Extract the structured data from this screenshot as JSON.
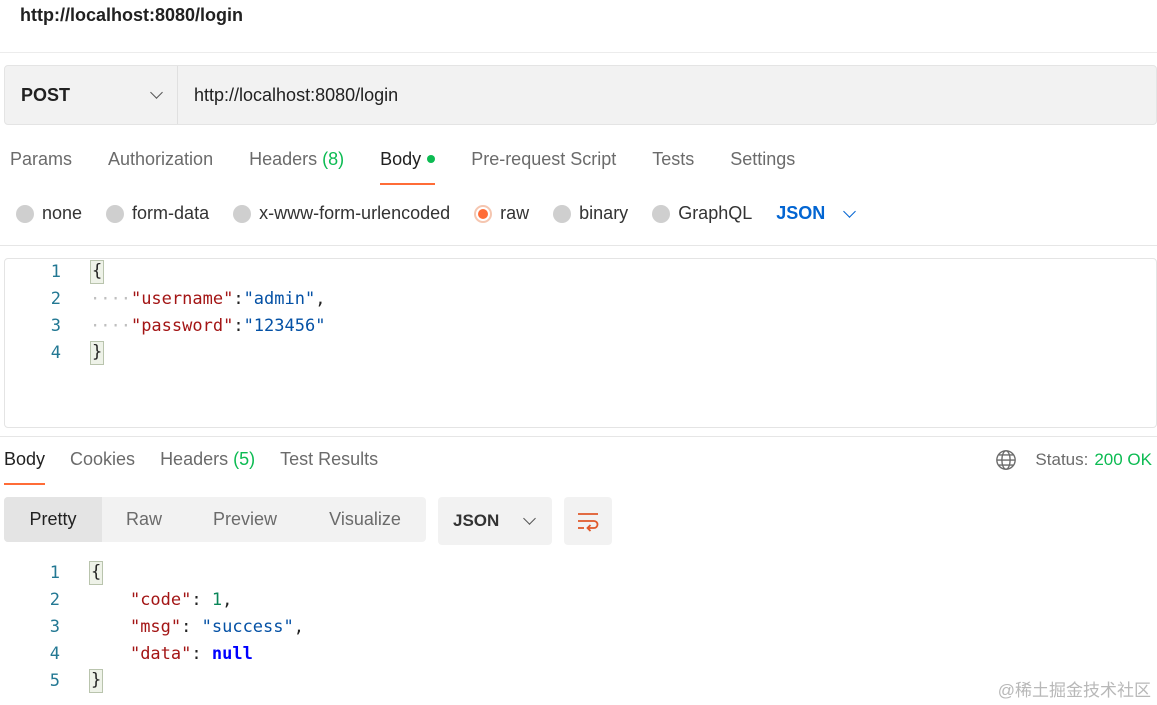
{
  "header": {
    "title": "http://localhost:8080/login"
  },
  "request": {
    "method": "POST",
    "url": "http://localhost:8080/login",
    "tabs": {
      "params": "Params",
      "authorization": "Authorization",
      "headers": "Headers",
      "headers_count": "(8)",
      "body": "Body",
      "prerequest": "Pre-request Script",
      "tests": "Tests",
      "settings": "Settings"
    },
    "active_tab": "Body",
    "body_types": {
      "none": "none",
      "form_data": "form-data",
      "urlencoded": "x-www-form-urlencoded",
      "raw": "raw",
      "binary": "binary",
      "graphql": "GraphQL"
    },
    "selected_body_type": "raw",
    "raw_language": "JSON",
    "editor": {
      "line_numbers": [
        "1",
        "2",
        "3",
        "4"
      ],
      "open_brace": "{",
      "close_brace": "}",
      "username_key": "\"username\"",
      "username_value": "\"admin\"",
      "password_key": "\"password\"",
      "password_value": "\"123456\""
    }
  },
  "response": {
    "tabs": {
      "body": "Body",
      "cookies": "Cookies",
      "headers": "Headers",
      "headers_count": "(5)",
      "test_results": "Test Results"
    },
    "active_tab": "Body",
    "status_label": "Status:",
    "status_value": "200 OK",
    "views": {
      "pretty": "Pretty",
      "raw": "Raw",
      "preview": "Preview",
      "visualize": "Visualize"
    },
    "active_view": "Pretty",
    "language": "JSON",
    "code": {
      "line_numbers": [
        "1",
        "2",
        "3",
        "4",
        "5"
      ],
      "open_brace": "{",
      "close_brace": "}",
      "code_key": "\"code\"",
      "code_value": "1",
      "msg_key": "\"msg\"",
      "msg_value": "\"success\"",
      "data_key": "\"data\"",
      "data_value": "null"
    }
  },
  "watermark": "@稀土掘金技术社区",
  "colors": {
    "accent": "#ff6c37",
    "success": "#0cbb52",
    "link": "#0265d2"
  },
  "icons": {
    "method_dropdown": "chevron-down-icon",
    "language_dropdown": "chevron-down-icon",
    "globe": "globe-icon",
    "wrap": "wrap-lines-icon"
  }
}
